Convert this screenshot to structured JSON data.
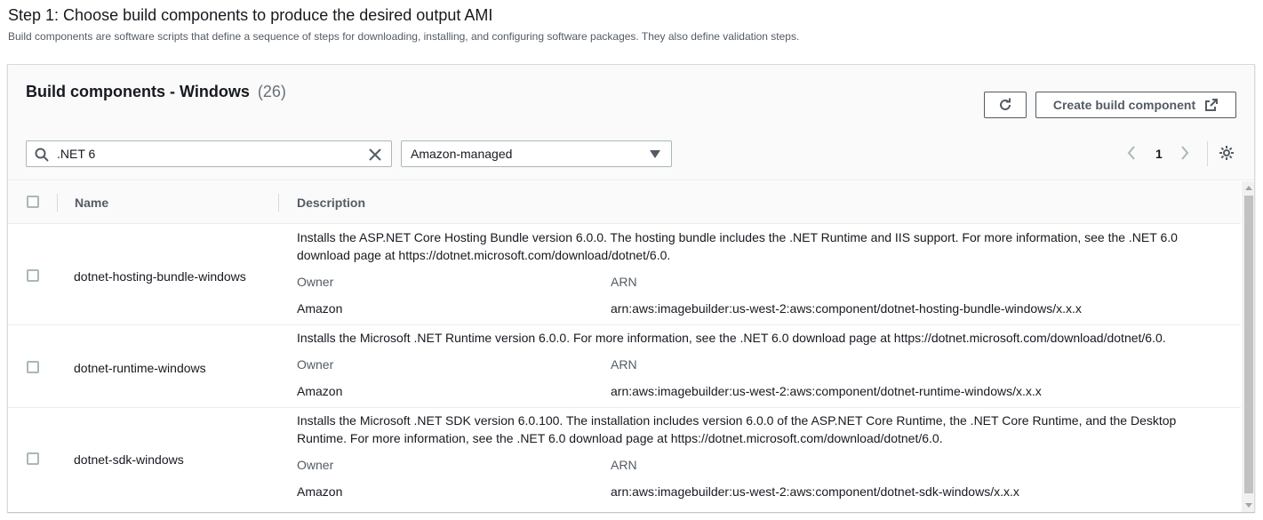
{
  "step": {
    "title": "Step 1: Choose build components to produce the desired output AMI",
    "subtitle": "Build components are software scripts that define a sequence of steps for downloading, installing, and configuring software packages. They also define validation steps."
  },
  "panel": {
    "title": "Build components - Windows",
    "count": "(26)",
    "create_label": "Create build component",
    "refresh_icon": "refresh-icon",
    "external_icon": "external-link-icon"
  },
  "search": {
    "value": ".NET 6",
    "icon": "search-icon",
    "clear_icon": "clear-icon"
  },
  "filter": {
    "selected": "Amazon-managed"
  },
  "pagination": {
    "current": "1"
  },
  "table": {
    "columns": [
      "Name",
      "Description"
    ],
    "owner_label": "Owner",
    "arn_label": "ARN",
    "rows": [
      {
        "name": "dotnet-hosting-bundle-windows",
        "description": "Installs the ASP.NET Core Hosting Bundle version 6.0.0. The hosting bundle includes the .NET Runtime and IIS support. For more information, see the .NET 6.0 download page at https://dotnet.microsoft.com/download/dotnet/6.0.",
        "owner": "Amazon",
        "arn": "arn:aws:imagebuilder:us-west-2:aws:component/dotnet-hosting-bundle-windows/x.x.x"
      },
      {
        "name": "dotnet-runtime-windows",
        "description": "Installs the Microsoft .NET Runtime version 6.0.0. For more information, see the .NET 6.0 download page at https://dotnet.microsoft.com/download/dotnet/6.0.",
        "owner": "Amazon",
        "arn": "arn:aws:imagebuilder:us-west-2:aws:component/dotnet-runtime-windows/x.x.x"
      },
      {
        "name": "dotnet-sdk-windows",
        "description": "Installs the Microsoft .NET SDK version 6.0.100. The installation includes version 6.0.0 of the ASP.NET Core Runtime, the .NET Core Runtime, and the Desktop Runtime. For more information, see the .NET 6.0 download page at https://dotnet.microsoft.com/download/dotnet/6.0.",
        "owner": "Amazon",
        "arn": "arn:aws:imagebuilder:us-west-2:aws:component/dotnet-sdk-windows/x.x.x"
      }
    ]
  }
}
